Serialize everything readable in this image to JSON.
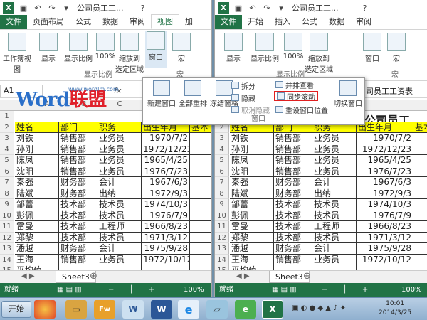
{
  "left_window": {
    "title": "公司员工工...",
    "tabs": [
      "文件",
      "页面布局",
      "公式",
      "数据",
      "审阅",
      "视图",
      "加"
    ],
    "ribbon_buttons": [
      "工作簿视图",
      "显示",
      "显示比例",
      "100%",
      "缩放到\n选定区域",
      "窗口",
      "宏"
    ],
    "group_labels": [
      "显示比例",
      "宏"
    ],
    "namebox": "A1",
    "sheet_tab": "Sheet3",
    "status": "就绪",
    "zoom": "100%"
  },
  "right_window": {
    "title": "公司员工工...",
    "tabs": [
      "文件",
      "开始",
      "插入",
      "公式",
      "数据",
      "审阅"
    ],
    "ribbon_buttons": [
      "显示",
      "显示比例",
      "100%",
      "缩放到\n选定区域",
      "窗口",
      "宏"
    ],
    "group_labels": [
      "显示比例",
      "宏"
    ],
    "formula_value": "司员工工资表",
    "sheet_tab": "Sheet3",
    "status": "就绪",
    "zoom": "100%",
    "header_partial": "公司员工"
  },
  "columns_left": [
    "A",
    "B",
    "C"
  ],
  "table_header": [
    "姓名",
    "部门",
    "职务",
    "出生年月",
    "基本"
  ],
  "rows": [
    [
      "刘铁",
      "销售部",
      "业务员",
      "1970/7/2"
    ],
    [
      "孙刚",
      "销售部",
      "业务员",
      "1972/12/23"
    ],
    [
      "陈凤",
      "销售部",
      "业务员",
      "1965/4/25"
    ],
    [
      "沈阳",
      "销售部",
      "业务员",
      "1976/7/23"
    ],
    [
      "秦强",
      "财务部",
      "会计",
      "1967/6/3"
    ],
    [
      "陆斌",
      "财务部",
      "出纳",
      "1972/9/3"
    ],
    [
      "邹蕾",
      "技术部",
      "技术员",
      "1974/10/3"
    ],
    [
      "彭佩",
      "技术部",
      "技术员",
      "1976/7/9"
    ],
    [
      "雷曼",
      "技术部",
      "工程师",
      "1966/8/23"
    ],
    [
      "郑黎",
      "技术部",
      "技术员",
      "1971/3/12"
    ],
    [
      "潘越",
      "财务部",
      "会计",
      "1975/9/28"
    ],
    [
      "王海",
      "销售部",
      "业务员",
      "1972/10/12"
    ]
  ],
  "last_row_label": "平均值",
  "window_menu": {
    "big_buttons": [
      "新建窗口",
      "全部重排",
      "冻结窗格",
      "切换窗口"
    ],
    "small_buttons": [
      "拆分",
      "隐藏",
      "取消隐藏",
      "并排查看",
      "同步滚动",
      "重设窗口位置"
    ],
    "group_label": "窗口"
  },
  "watermark": {
    "word": "Word",
    "cn": "联盟",
    "url": "www.wordlm.com"
  },
  "taskbar": {
    "start": "开始",
    "clock_time": "10:01",
    "clock_date": "2014/3/25"
  }
}
